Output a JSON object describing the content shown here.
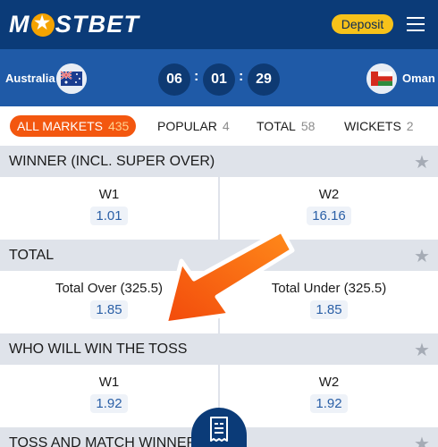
{
  "header": {
    "logo_text_1": "M",
    "logo_text_2": "STBET",
    "deposit_label": "Deposit"
  },
  "match": {
    "home_team": "Australia",
    "away_team": "Oman",
    "timer": {
      "hours": "06",
      "minutes": "01",
      "seconds": "29"
    }
  },
  "tabs": [
    {
      "label": "ALL MARKETS",
      "count": "435",
      "active": true
    },
    {
      "label": "POPULAR",
      "count": "4"
    },
    {
      "label": "TOTAL",
      "count": "58"
    },
    {
      "label": "WICKETS",
      "count": "2"
    }
  ],
  "markets": [
    {
      "title": "WINNER (INCL. SUPER OVER)",
      "outcomes": [
        {
          "label": "W1",
          "odd": "1.01"
        },
        {
          "label": "W2",
          "odd": "16.16"
        }
      ]
    },
    {
      "title": "TOTAL",
      "outcomes": [
        {
          "label": "Total Over (325.5)",
          "odd": "1.85"
        },
        {
          "label": "Total Under (325.5)",
          "odd": "1.85"
        }
      ]
    },
    {
      "title": "WHO WILL WIN THE TOSS",
      "outcomes": [
        {
          "label": "W1",
          "odd": "1.92"
        },
        {
          "label": "W2",
          "odd": "1.92"
        }
      ]
    },
    {
      "title": "TOSS AND MATCH WINNER"
    }
  ],
  "colors": {
    "brand_dark": "#0b3b78",
    "brand_blue": "#1f5aa7",
    "accent_orange": "#f3570f",
    "deposit_yellow": "#f7c21a"
  },
  "icons": [
    "star-icon",
    "menu-icon",
    "flag-australia-icon",
    "flag-oman-icon",
    "bet-slip-icon",
    "arrow-annotation"
  ]
}
